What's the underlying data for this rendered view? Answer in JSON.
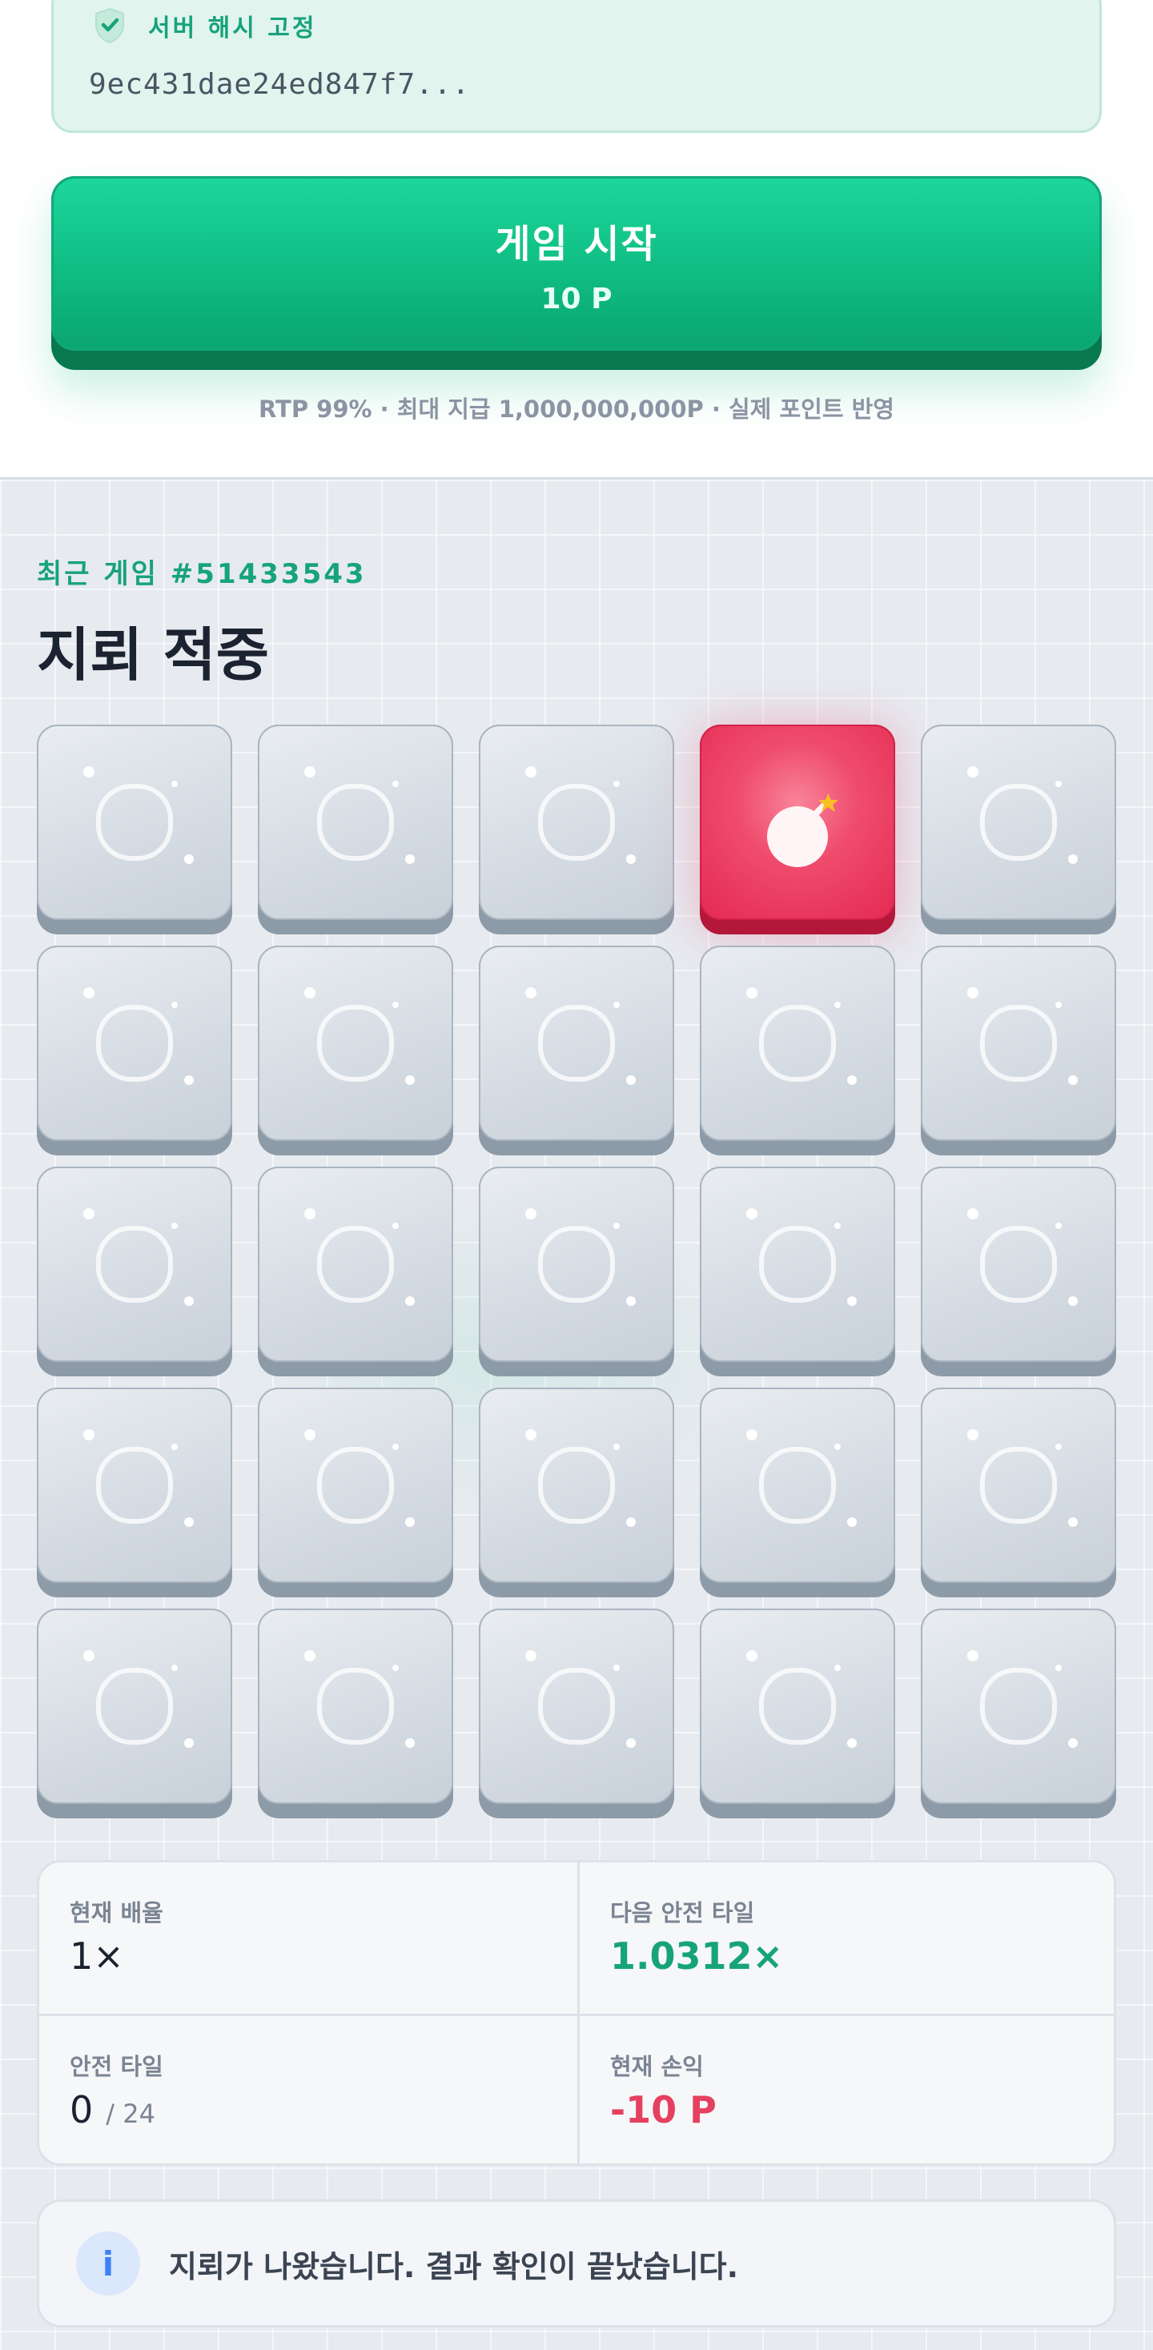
{
  "server_hash": {
    "title": "서버 해시 고정",
    "value": "9ec431dae24ed847f7...",
    "icon": "shield-check-icon"
  },
  "start_button": {
    "label": "게임 시작",
    "cost": "10 P"
  },
  "rtp_note": "RTP 99% · 최대 지급 1,000,000,000P · 실제 포인트 반영",
  "recent_game": {
    "label": "최근 게임 #51433543",
    "result_title": "지뢰 적중"
  },
  "board": {
    "rows": 5,
    "cols": 5,
    "revealed_mine": {
      "row": 1,
      "col": 4
    },
    "colors": {
      "tile": "#d4dbe2",
      "mine": "#e42a52"
    }
  },
  "stats": {
    "current_multiplier": {
      "label": "현재 배율",
      "value": "1×"
    },
    "next_safe_tile": {
      "label": "다음 안전 타일",
      "value": "1.0312×"
    },
    "safe_tiles": {
      "label": "안전 타일",
      "value": "0",
      "total": "/ 24"
    },
    "current_profit": {
      "label": "현재 손익",
      "value": "-10 P"
    }
  },
  "notice": {
    "icon": "info-icon",
    "icon_glyph": "i",
    "text": "지뢰가 나왔습니다. 결과 확인이 끝났습니다."
  },
  "colors": {
    "accent_green": "#17a37a",
    "loss_red": "#e5405f",
    "info_blue": "#3b82f6"
  }
}
